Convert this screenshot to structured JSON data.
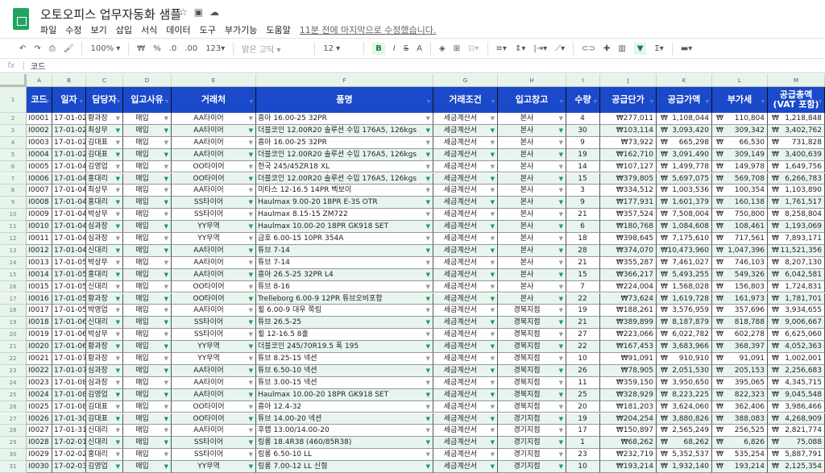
{
  "app": {
    "title": "오토오피스 업무자동화 샘플",
    "title_icons": [
      "star-icon",
      "move-folder-icon",
      "cloud-status-icon"
    ],
    "menu": [
      "파일",
      "수정",
      "보기",
      "삽입",
      "서식",
      "데이터",
      "도구",
      "부가기능",
      "도움말"
    ],
    "last_edit": "11분 전에 마지막으로 수정했습니다."
  },
  "toolbar": {
    "zoom": "100%",
    "currency": "₩",
    "percent": "%",
    "dec_less": ".0",
    "dec_more": ".00",
    "format": "123",
    "font": "맑은 고딕",
    "font_size": "12",
    "bold": "B",
    "italic": "I",
    "strike": "S",
    "text_color": "A"
  },
  "formula_bar": {
    "fx": "fx",
    "value": "코드"
  },
  "columns": [
    "A",
    "B",
    "C",
    "D",
    "E",
    "F",
    "G",
    "H",
    "I",
    "J",
    "K",
    "L",
    "M"
  ],
  "headers": [
    "코드",
    "일자",
    "담당자",
    "입고사유",
    "거래처",
    "품명",
    "거래조건",
    "입고창고",
    "수량",
    "공급단가",
    "공급가액",
    "부가세",
    "공급총액\n(VAT 포함)"
  ],
  "currency_symbol": "₩",
  "rows": [
    [
      "I0001",
      "17-01-02",
      "황과장",
      "매입",
      "AA타이어",
      "흥아 16.00-25 32PR",
      "세금계산서",
      "본사",
      "4",
      "₩277,011",
      "1,108,044",
      "110,804",
      "1,218,848"
    ],
    [
      "I0002",
      "17-01-02",
      "최상무",
      "매입",
      "AA타이어",
      "더블코인 12.00R20 솔루션 수입 176A5, 126kgs",
      "세금계산서",
      "본사",
      "30",
      "₩103,114",
      "3,093,420",
      "309,342",
      "3,402,762"
    ],
    [
      "I0003",
      "17-01-02",
      "김대표",
      "매입",
      "AA타이어",
      "흥아 16.00-25 32PR",
      "세금계산서",
      "본사",
      "9",
      "₩73,922",
      "665,298",
      "66,530",
      "731,828"
    ],
    [
      "I0004",
      "17-01-02",
      "김대표",
      "매입",
      "AA타이어",
      "더블코인 12.00R20 솔루션 수입 176A5, 126kgs",
      "세금계산서",
      "본사",
      "19",
      "₩162,710",
      "3,091,490",
      "309,149",
      "3,400,639"
    ],
    [
      "I0005",
      "17-01-04",
      "김영업",
      "매입",
      "OO타이어",
      "한국 245/45ZR18 XL",
      "세금계산서",
      "본사",
      "14",
      "₩107,127",
      "1,499,778",
      "149,978",
      "1,649,756"
    ],
    [
      "I0006",
      "17-01-04",
      "홍대리",
      "매입",
      "OO타이어",
      "더블코인 12.00R20 솔루션 수입 176A5, 126kgs",
      "세금계산서",
      "본사",
      "15",
      "₩379,805",
      "5,697,075",
      "569,708",
      "6,266,783"
    ],
    [
      "I0007",
      "17-01-04",
      "최상무",
      "매입",
      "AA타이어",
      "미타스 12-16.5 14PR 벡보이",
      "세금계산서",
      "본사",
      "3",
      "₩334,512",
      "1,003,536",
      "100,354",
      "1,103,890"
    ],
    [
      "I0008",
      "17-01-04",
      "홍대리",
      "매입",
      "SS타이어",
      "Haulmax 9.00-20 18PR E-3S OTR",
      "세금계산서",
      "본사",
      "9",
      "₩177,931",
      "1,601,379",
      "160,138",
      "1,761,517"
    ],
    [
      "I0009",
      "17-01-04",
      "박상무",
      "매입",
      "SS타이어",
      "Haulmax 8.15-15 ZM722",
      "세금계산서",
      "본사",
      "21",
      "₩357,524",
      "7,508,004",
      "750,800",
      "8,258,804"
    ],
    [
      "I0010",
      "17-01-04",
      "심과장",
      "매입",
      "YY무역",
      "Haulmax 10.00-20 18PR GK918 SET",
      "세금계산서",
      "본사",
      "6",
      "₩180,768",
      "1,084,608",
      "108,461",
      "1,193,069"
    ],
    [
      "I0011",
      "17-01-04",
      "심과장",
      "매입",
      "YY무역",
      "금호 6.00-15 10PR 354A",
      "세금계산서",
      "본사",
      "18",
      "₩398,645",
      "7,175,610",
      "717,561",
      "7,893,171"
    ],
    [
      "I0012",
      "17-01-04",
      "신대리",
      "매입",
      "AA타이어",
      "튜브 7-14",
      "세금계산서",
      "본사",
      "28",
      "₩374,070",
      "10,473,960",
      "1,047,396",
      "11,521,356"
    ],
    [
      "I0013",
      "17-01-05",
      "박상무",
      "매입",
      "AA타이어",
      "튜브 7-14",
      "세금계산서",
      "본사",
      "21",
      "₩355,287",
      "7,461,027",
      "746,103",
      "8,207,130"
    ],
    [
      "I0014",
      "17-01-05",
      "홍대리",
      "매입",
      "AA타이어",
      "흥아 26.5-25 32PR L4",
      "세금계산서",
      "본사",
      "15",
      "₩366,217",
      "5,493,255",
      "549,326",
      "6,042,581"
    ],
    [
      "I0015",
      "17-01-05",
      "신대리",
      "매입",
      "OO타이어",
      "튜브 8-16",
      "세금계산서",
      "본사",
      "7",
      "₩224,004",
      "1,568,028",
      "156,803",
      "1,724,831"
    ],
    [
      "I0016",
      "17-01-05",
      "황과장",
      "매입",
      "OO타이어",
      "Trelleborg 6.00-9 12PR 튜브오비포함",
      "세금계산서",
      "본사",
      "22",
      "₩73,624",
      "1,619,728",
      "161,973",
      "1,781,701"
    ],
    [
      "I0017",
      "17-01-05",
      "박영업",
      "매입",
      "AA타이어",
      "휠 6.00-9 대우 쪽림",
      "세금계산서",
      "경북지점",
      "19",
      "₩188,261",
      "3,576,959",
      "357,696",
      "3,934,655"
    ],
    [
      "I0018",
      "17-01-06",
      "신대리",
      "매입",
      "SS타이어",
      "튜브 26.5-25",
      "세금계산서",
      "경북지점",
      "21",
      "₩389,899",
      "8,187,879",
      "818,788",
      "9,006,667"
    ],
    [
      "I0019",
      "17-01-06",
      "박상무",
      "매입",
      "SS타이어",
      "휠 12-16.5 8홀",
      "세금계산서",
      "경북지점",
      "27",
      "₩223,066",
      "6,022,782",
      "602,278",
      "6,625,060"
    ],
    [
      "I0020",
      "17-01-06",
      "황과장",
      "매입",
      "YY무역",
      "더블코인 245/70R19.5 폭 195",
      "세금계산서",
      "경북지점",
      "22",
      "₩167,453",
      "3,683,966",
      "368,397",
      "4,052,363"
    ],
    [
      "I0021",
      "17-01-07",
      "황과장",
      "매입",
      "YY무역",
      "튜브 8.25-15 넥션",
      "세금계산서",
      "경북지점",
      "10",
      "₩91,091",
      "910,910",
      "91,091",
      "1,002,001"
    ],
    [
      "I0022",
      "17-01-07",
      "심과장",
      "매입",
      "AA타이어",
      "튜브 6.50-10 넥션",
      "세금계산서",
      "경북지점",
      "26",
      "₩78,905",
      "2,051,530",
      "205,153",
      "2,256,683"
    ],
    [
      "I0023",
      "17-01-08",
      "심과장",
      "매입",
      "AA타이어",
      "튜브 3.00-15 넥션",
      "세금계산서",
      "경북지점",
      "11",
      "₩359,150",
      "3,950,650",
      "395,065",
      "4,345,715"
    ],
    [
      "I0024",
      "17-01-08",
      "김영업",
      "매입",
      "AA타이어",
      "Haulmax 10.00-20 18PR GK918 SET",
      "세금계산서",
      "경북지점",
      "25",
      "₩328,929",
      "8,223,225",
      "822,323",
      "9,045,548"
    ],
    [
      "I0025",
      "17-01-08",
      "김대표",
      "매입",
      "OO타이어",
      "흥아 12.4-32",
      "세금계산서",
      "경북지점",
      "20",
      "₩181,203",
      "3,624,060",
      "362,406",
      "3,986,466"
    ],
    [
      "I0026",
      "17-01-30",
      "김대표",
      "매입",
      "OO타이어",
      "튜브 14.00-20 넥션",
      "세금계산서",
      "경기지점",
      "19",
      "₩204,254",
      "3,880,826",
      "388,083",
      "4,268,909"
    ],
    [
      "I0027",
      "17-01-31",
      "신대리",
      "매입",
      "AA타이어",
      "후랩 13.00/14.00-20",
      "세금계산서",
      "경기지점",
      "17",
      "₩150,897",
      "2,565,249",
      "256,525",
      "2,821,774"
    ],
    [
      "I0028",
      "17-02-01",
      "신대리",
      "매입",
      "SS타이어",
      "링롱 18.4R38 (460/85R38)",
      "세금계산서",
      "경기지점",
      "1",
      "₩68,262",
      "68,262",
      "6,826",
      "75,088"
    ],
    [
      "I0029",
      "17-02-02",
      "홍대리",
      "매입",
      "SS타이어",
      "링롱 6.50-10 LL",
      "세금계산서",
      "경기지점",
      "23",
      "₩232,719",
      "5,352,537",
      "535,254",
      "5,887,791"
    ],
    [
      "I0030",
      "17-02-03",
      "김영업",
      "매입",
      "YY무역",
      "링롱 7.00-12 LL 신형",
      "세금계산서",
      "경기지점",
      "10",
      "₩193,214",
      "1,932,140",
      "193,214",
      "2,125,354"
    ]
  ]
}
